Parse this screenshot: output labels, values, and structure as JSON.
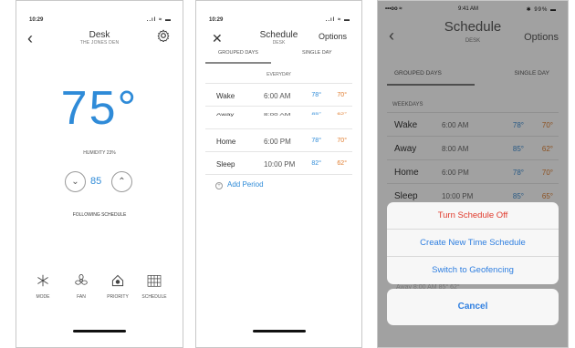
{
  "thermostat": {
    "status_time": "10:29",
    "status_icons": "..ıl ≈ ▬",
    "back_glyph": "‹",
    "title": "Desk",
    "subtitle": "THE JONES DEN",
    "temperature": "75°",
    "humidity": "HUMIDITY 23%",
    "setpoint": "85",
    "down_glyph": "⌄",
    "up_glyph": "⌃",
    "following": "FOLLOWING SCHEDULE",
    "nav": [
      {
        "label": "MODE",
        "icon": "snowflake-icon"
      },
      {
        "label": "FAN",
        "icon": "fan-icon"
      },
      {
        "label": "PRIORITY",
        "icon": "home-priority-icon"
      },
      {
        "label": "SCHEDULE",
        "icon": "calendar-icon"
      }
    ]
  },
  "schedule": {
    "status_time": "10:29",
    "status_icons": "..ıl ≈ ▬",
    "close_glyph": "✕",
    "title": "Schedule",
    "subtitle": "DESK",
    "options": "Options",
    "tabs": [
      "GROUPED DAYS",
      "SINGLE DAY"
    ],
    "day_label": "EVERYDAY",
    "rows": [
      {
        "period": "Wake",
        "time": "6:00 AM",
        "cool": "78°",
        "heat": "70°"
      },
      {
        "period": "Away",
        "time": "8:00 AM",
        "cool": "85°",
        "heat": "62°"
      },
      {
        "period": "Home",
        "time": "6:00 PM",
        "cool": "78°",
        "heat": "70°"
      },
      {
        "period": "Sleep",
        "time": "10:00 PM",
        "cool": "82°",
        "heat": "62°"
      }
    ],
    "add_period": "Add Period",
    "add_glyph": "+"
  },
  "action_sheet_screen": {
    "status_left": "•••oo ≈",
    "status_time": "9:41 AM",
    "status_right": "✱ 99% ▬",
    "back_glyph": "‹",
    "title": "Schedule",
    "subtitle": "DESK",
    "options": "Options",
    "tabs": [
      "GROUPED DAYS",
      "SINGLE DAY"
    ],
    "weekdays": "WEEKDAYS",
    "rows": [
      {
        "period": "Wake",
        "time": "6:00 AM",
        "cool": "78°",
        "heat": "70°"
      },
      {
        "period": "Away",
        "time": "8:00 AM",
        "cool": "85°",
        "heat": "62°"
      },
      {
        "period": "Home",
        "time": "6:00 PM",
        "cool": "78°",
        "heat": "70°"
      },
      {
        "period": "Sleep",
        "time": "10:00 PM",
        "cool": "85°",
        "heat": "65°"
      }
    ],
    "peek_text": "Away       8:00 AM                               85°  62°",
    "actions": [
      "Turn Schedule Off",
      "Create New Time Schedule",
      "Switch to Geofencing"
    ],
    "cancel": "Cancel"
  }
}
